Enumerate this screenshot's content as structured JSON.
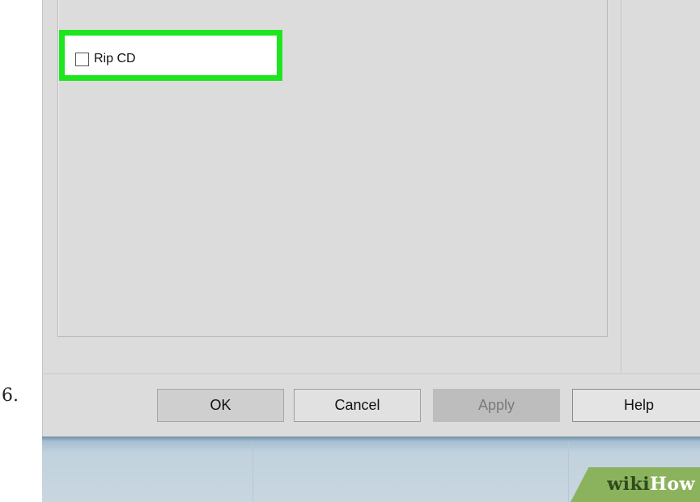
{
  "step": {
    "number": "6."
  },
  "dialog": {
    "checkbox": {
      "label": "Rip CD",
      "checked": false
    },
    "highlight_color": "#1ee61e",
    "buttons": {
      "ok": "OK",
      "cancel": "Cancel",
      "apply": "Apply",
      "help": "Help"
    },
    "apply_disabled": true
  },
  "watermark": {
    "part1": "wiki",
    "part2": "How"
  }
}
